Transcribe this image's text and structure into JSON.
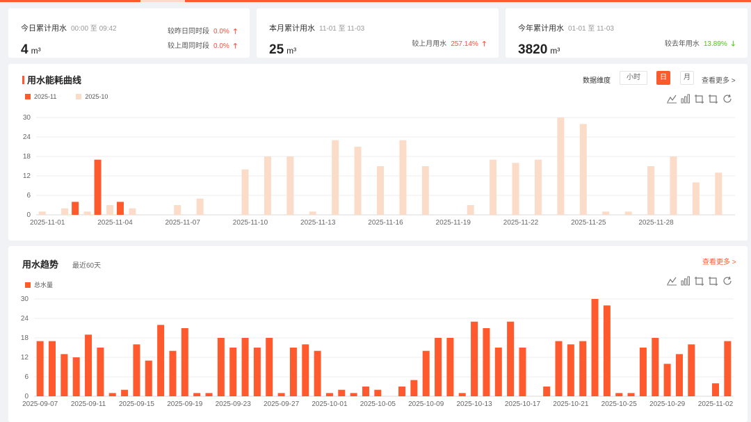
{
  "colors": {
    "accent": "#ff5a2e",
    "prev_series": "#fbdcc8",
    "up": "#ff4d3a",
    "down": "#52c41a"
  },
  "stats": [
    {
      "title": "今日累计用水",
      "range": "00:00 至 09:42",
      "value": "4",
      "unit": "m³",
      "comparisons": [
        {
          "label": "较昨日同时段",
          "pct": "0.0%",
          "trend": "up"
        },
        {
          "label": "较上周同时段",
          "pct": "0.0%",
          "trend": "up"
        }
      ]
    },
    {
      "title": "本月累计用水",
      "range": "11-01 至 11-03",
      "value": "25",
      "unit": "m³",
      "comparisons": [
        {
          "label": "较上月用水",
          "pct": "257.14%",
          "trend": "up"
        }
      ]
    },
    {
      "title": "今年累计用水",
      "range": "01-01 至 11-03",
      "value": "3820",
      "unit": "m³",
      "comparisons": [
        {
          "label": "较去年用水",
          "pct": "13.89%",
          "trend": "down"
        }
      ]
    }
  ],
  "curve_panel": {
    "title": "用水能耗曲线",
    "dimension_label": "数据维度",
    "dimension_options": [
      "小时",
      "日",
      "月"
    ],
    "dimension_selected": "日",
    "more_label": "查看更多 >",
    "toolbox_icons": [
      "line-chart-icon",
      "bar-chart-icon",
      "stack-icon",
      "tiled-icon",
      "restore-icon"
    ]
  },
  "trend_panel": {
    "title": "用水趋势",
    "subtitle": "最近60天",
    "more_label": "查看更多 >",
    "toolbox_icons": [
      "line-chart-icon",
      "bar-chart-icon",
      "stack-icon",
      "tiled-icon",
      "restore-icon"
    ]
  },
  "chart_data": [
    {
      "type": "bar",
      "title": "",
      "series": [
        {
          "name": "2025-11",
          "color": "#ff5a2e",
          "values": [
            0,
            4,
            17,
            4,
            null,
            null,
            null,
            null,
            null,
            null,
            null,
            null,
            null,
            null,
            null,
            null,
            null,
            null,
            null,
            null,
            null,
            null,
            null,
            null,
            null,
            null,
            null,
            null,
            null,
            null
          ]
        },
        {
          "name": "2025-10",
          "color": "#fbdcc8",
          "values": [
            1,
            2,
            1,
            3,
            2,
            0,
            3,
            5,
            0,
            14,
            18,
            18,
            1,
            23,
            21,
            15,
            23,
            15,
            0,
            3,
            17,
            16,
            17,
            30,
            28,
            1,
            1,
            15,
            18,
            10,
            13
          ]
        }
      ],
      "x_tick_labels": [
        "2025-11-01",
        "2025-11-04",
        "2025-11-07",
        "2025-11-10",
        "2025-11-13",
        "2025-11-16",
        "2025-11-19",
        "2025-11-22",
        "2025-11-25",
        "2025-11-28"
      ],
      "y_ticks": [
        0,
        6,
        12,
        18,
        24,
        30
      ],
      "ylim": [
        0,
        30
      ],
      "grid": true,
      "legend": "top-left"
    },
    {
      "type": "bar",
      "title": "",
      "series": [
        {
          "name": "总水量",
          "color": "#ff5a2e",
          "values": [
            17,
            17,
            13,
            12,
            19,
            15,
            1,
            2,
            16,
            11,
            22,
            14,
            21,
            1,
            1,
            18,
            15,
            18,
            15,
            18,
            1,
            15,
            16,
            14,
            1,
            2,
            1,
            3,
            2,
            0,
            3,
            5,
            14,
            18,
            18,
            1,
            23,
            21,
            15,
            23,
            15,
            0,
            3,
            17,
            16,
            17,
            30,
            28,
            1,
            1,
            15,
            18,
            10,
            13,
            16,
            0,
            4,
            17
          ]
        }
      ],
      "x_tick_labels": [
        "2025-09-07",
        "2025-09-11",
        "2025-09-15",
        "2025-09-19",
        "2025-09-23",
        "2025-09-27",
        "2025-10-01",
        "2025-10-05",
        "2025-10-09",
        "2025-10-13",
        "2025-10-17",
        "2025-10-21",
        "2025-10-25",
        "2025-10-29",
        "2025-11-02"
      ],
      "y_ticks": [
        0,
        6,
        12,
        18,
        24,
        30
      ],
      "ylim": [
        0,
        30
      ],
      "grid": true,
      "legend": "top-left"
    }
  ]
}
